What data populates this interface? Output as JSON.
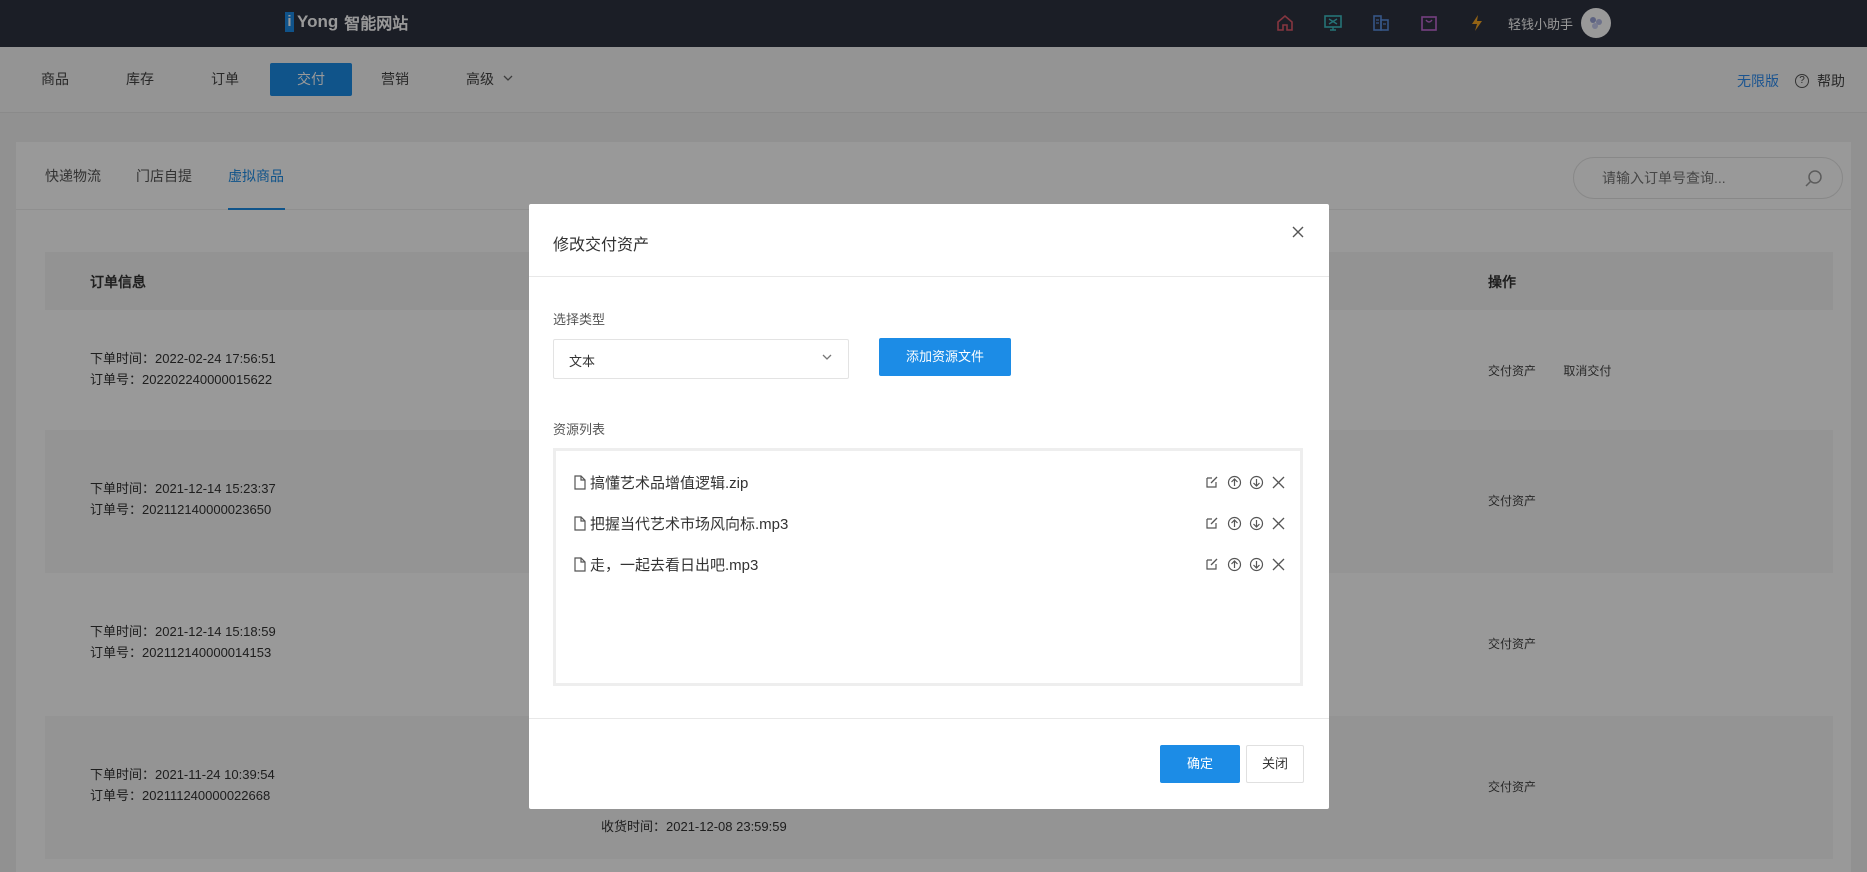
{
  "topbar": {
    "logo_mark": "i",
    "logo_text": "Yong",
    "logo_cn": "智能网站",
    "icons": [
      "home-icon",
      "monitor-icon",
      "building-icon",
      "bag-icon",
      "bolt-icon"
    ],
    "user_name": "轻钱小助手",
    "colors": {
      "home": "#e05a6b",
      "monitor": "#3ec0c6",
      "building": "#5b8fe0",
      "bag": "#c36bd6",
      "bolt": "#f5a623"
    }
  },
  "nav": {
    "items": [
      "商品",
      "库存",
      "订单",
      "交付",
      "营销",
      "高级"
    ],
    "active": "交付",
    "unlimited": "无限版",
    "help": "帮助"
  },
  "subtabs": {
    "items": [
      "快递物流",
      "门店自提",
      "虚拟商品"
    ],
    "active": "虚拟商品"
  },
  "search": {
    "placeholder": "请输入订单号查询..."
  },
  "table": {
    "headers": {
      "info": "订单信息",
      "ops": "操作"
    },
    "rows": [
      {
        "time": "下单时间：2022-02-24 17:56:51",
        "order": "订单号：202202240000015622",
        "ops": [
          "交付资产",
          "取消交付"
        ]
      },
      {
        "time": "下单时间：2021-12-14 15:23:37",
        "order": "订单号：202112140000023650",
        "ops": [
          "交付资产"
        ]
      },
      {
        "time": "下单时间：2021-12-14 15:18:59",
        "order": "订单号：202112140000014153",
        "ops": [
          "交付资产"
        ]
      },
      {
        "time": "下单时间：2021-11-24 10:39:54",
        "order": "订单号：202111240000022668",
        "ops": [
          "交付资产"
        ],
        "receive": "收货时间：2021-12-08 23:59:59"
      }
    ]
  },
  "modal": {
    "title": "修改交付资产",
    "type_label": "选择类型",
    "type_value": "文本",
    "add_button": "添加资源文件",
    "list_label": "资源列表",
    "files": [
      "搞懂艺术品增值逻辑.zip",
      "把握当代艺术市场风向标.mp3",
      "走，一起去看日出吧.mp3"
    ],
    "ok": "确定",
    "cancel": "关闭"
  }
}
